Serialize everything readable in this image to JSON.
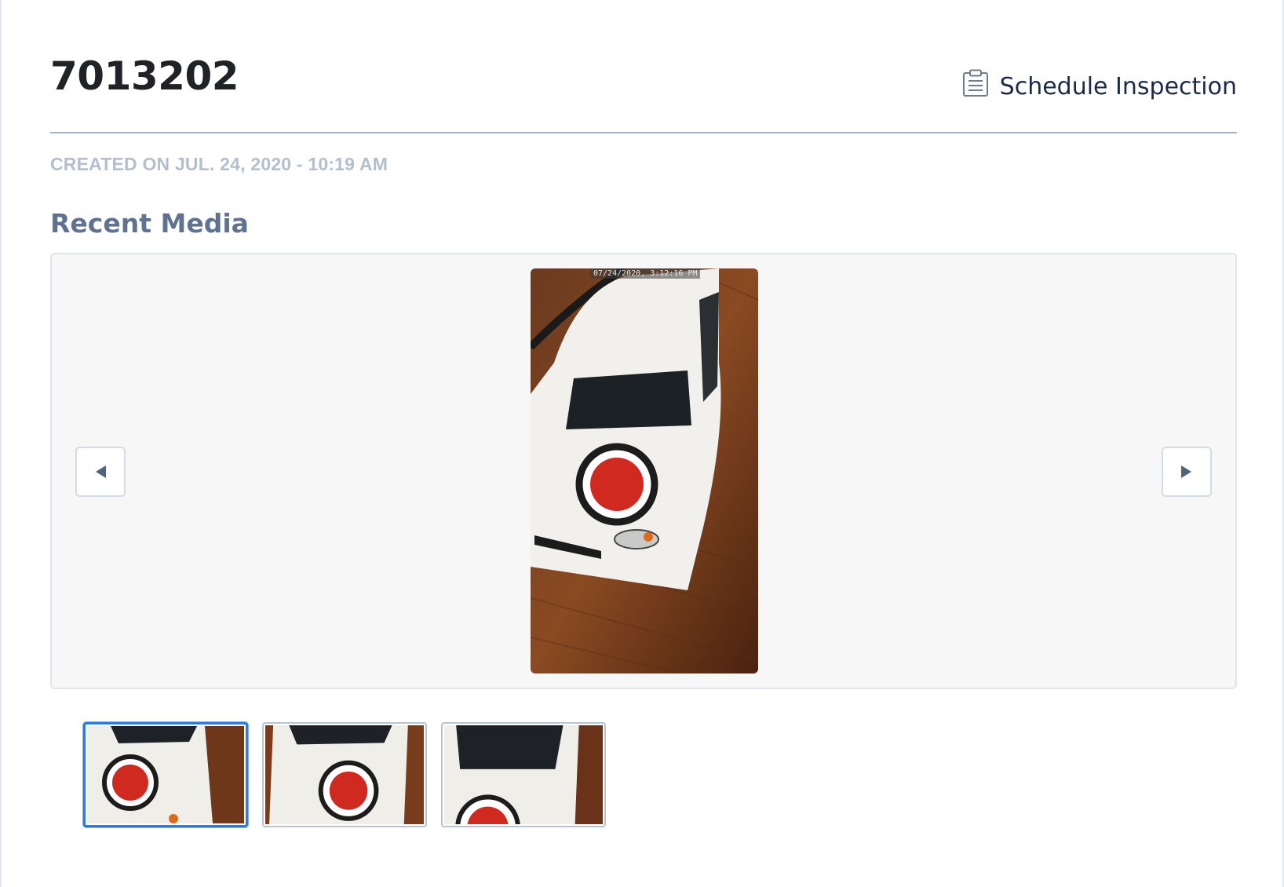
{
  "header": {
    "title": "7013202",
    "action_label": "Schedule Inspection",
    "action_icon": "clipboard-icon"
  },
  "meta": {
    "created_text": "CREATED ON JUL. 24, 2020 - 10:19 AM"
  },
  "media": {
    "section_title": "Recent Media",
    "timestamp": "07/24/2020, 3:12:16 PM",
    "prev_icon": "chevron-left-icon",
    "next_icon": "chevron-right-icon",
    "thumbnail_count": 3,
    "selected_index": 0
  },
  "colors": {
    "accent": "#2b7be0",
    "title": "#202226",
    "link": "#1a2b49",
    "muted": "#b3bfcd",
    "section": "#5f7290"
  }
}
